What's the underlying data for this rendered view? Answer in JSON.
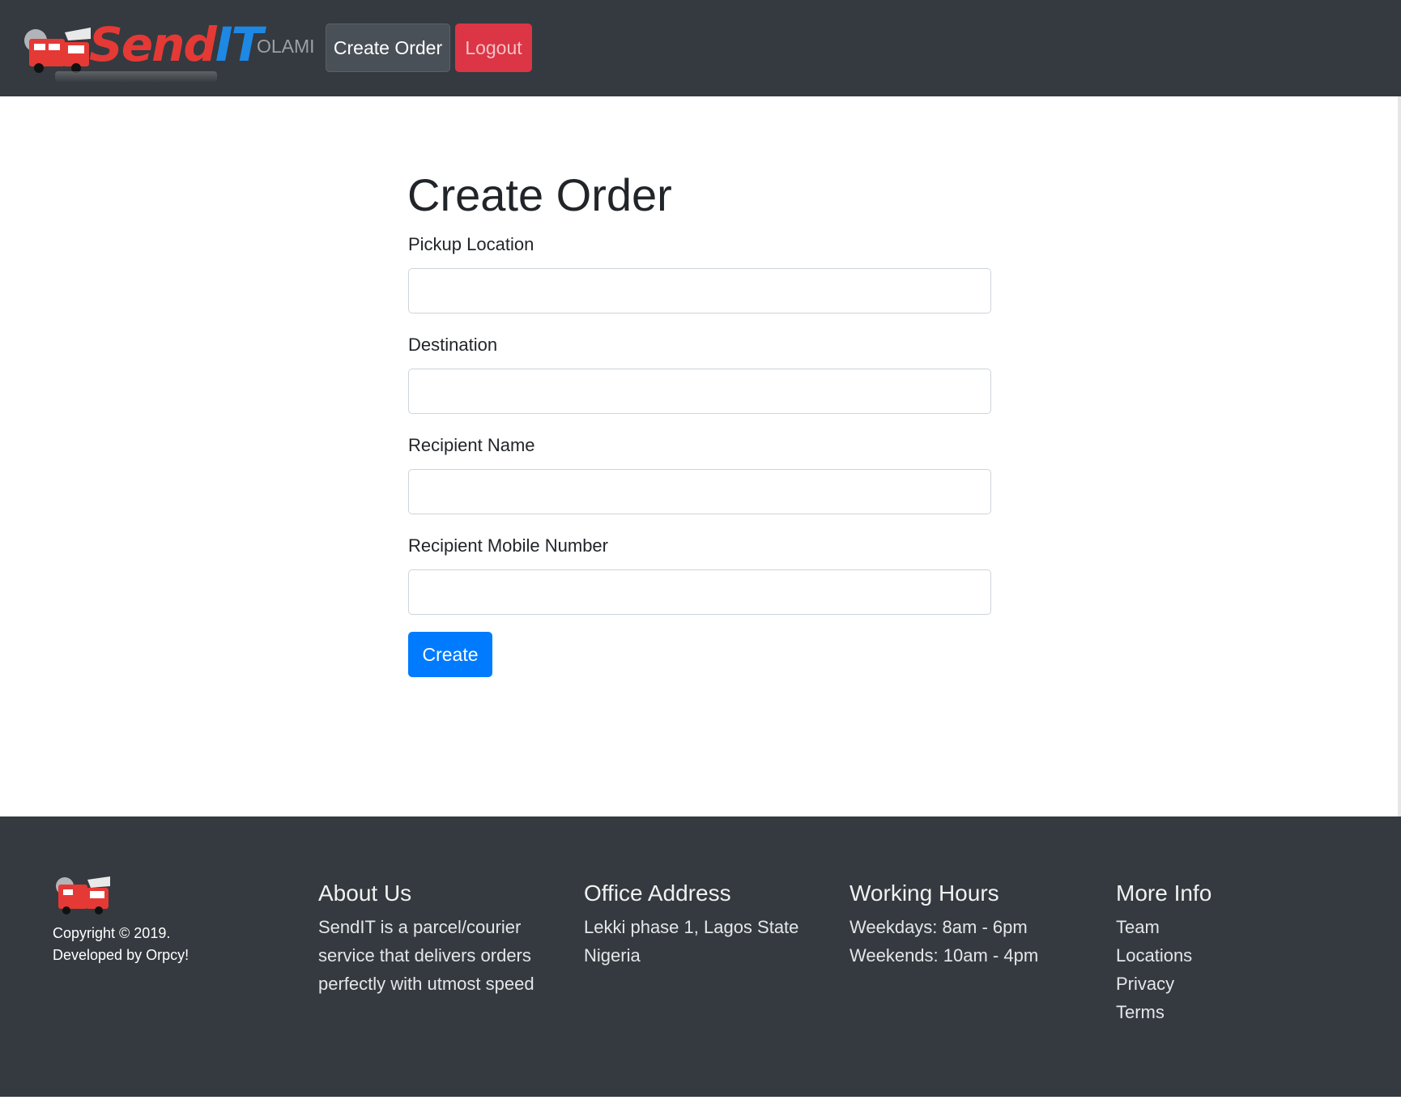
{
  "navbar": {
    "brand_send": "Send",
    "brand_it": "IT",
    "username": "OLAMI",
    "create_order_label": "Create Order",
    "logout_label": "Logout"
  },
  "form": {
    "title": "Create Order",
    "fields": [
      {
        "label": "Pickup Location",
        "value": ""
      },
      {
        "label": "Destination",
        "value": ""
      },
      {
        "label": "Recipient Name",
        "value": ""
      },
      {
        "label": "Recipient Mobile Number",
        "value": ""
      }
    ],
    "submit_label": "Create"
  },
  "footer": {
    "copyright": "Copyright © 2019.",
    "developed_by": "Developed by Orpcy!",
    "about": {
      "heading": "About Us",
      "lines": [
        "SendIT is a parcel/courier",
        "service that delivers orders",
        "perfectly with utmost speed"
      ]
    },
    "office": {
      "heading": "Office Address",
      "lines": [
        "Lekki phase 1, Lagos State",
        "Nigeria"
      ]
    },
    "hours": {
      "heading": "Working Hours",
      "lines": [
        "Weekdays: 8am - 6pm",
        "Weekends: 10am - 4pm"
      ]
    },
    "more": {
      "heading": "More Info",
      "links": [
        "Team",
        "Locations",
        "Privacy",
        "Terms"
      ]
    }
  },
  "colors": {
    "navbar_bg": "#343a40",
    "primary": "#007bff",
    "danger": "#dc3545",
    "brand_red": "#e53935",
    "brand_blue": "#1e88e5"
  },
  "icons": {
    "brand_logo": "truck-icon",
    "footer_logo": "truck-icon"
  }
}
